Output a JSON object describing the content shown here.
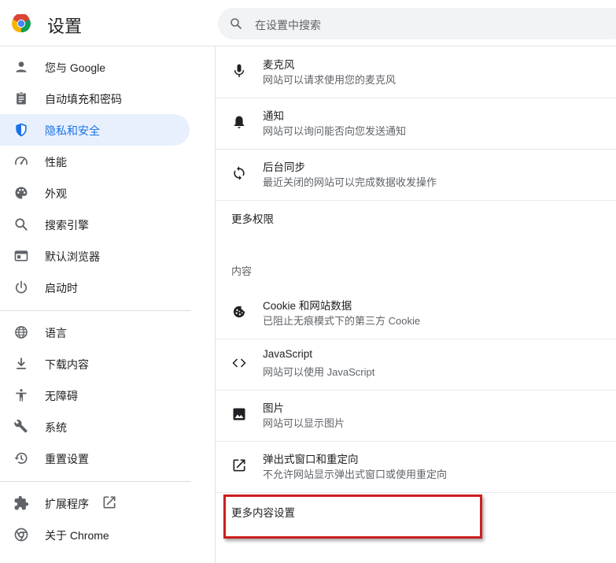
{
  "header": {
    "title": "设置",
    "search_placeholder": "在设置中搜索"
  },
  "sidebar": {
    "items": [
      {
        "label": "您与 Google",
        "icon": "person-icon"
      },
      {
        "label": "自动填充和密码",
        "icon": "clipboard-icon"
      },
      {
        "label": "隐私和安全",
        "icon": "shield-icon",
        "active": true
      },
      {
        "label": "性能",
        "icon": "speedometer-icon"
      },
      {
        "label": "外观",
        "icon": "palette-icon"
      },
      {
        "label": "搜索引擎",
        "icon": "search-icon"
      },
      {
        "label": "默认浏览器",
        "icon": "browser-window-icon"
      },
      {
        "label": "启动时",
        "icon": "power-icon"
      },
      {
        "label": "语言",
        "icon": "globe-icon"
      },
      {
        "label": "下载内容",
        "icon": "download-icon"
      },
      {
        "label": "无障碍",
        "icon": "accessibility-icon"
      },
      {
        "label": "系统",
        "icon": "wrench-icon"
      },
      {
        "label": "重置设置",
        "icon": "history-icon"
      },
      {
        "label": "扩展程序",
        "icon": "puzzle-icon"
      },
      {
        "label": "关于 Chrome",
        "icon": "chrome-icon"
      }
    ]
  },
  "content": {
    "rows_top": [
      {
        "title": "麦克风",
        "sub": "网站可以请求使用您的麦克风",
        "icon": "microphone-icon"
      },
      {
        "title": "通知",
        "sub": "网站可以询问能否向您发送通知",
        "icon": "bell-icon"
      },
      {
        "title": "后台同步",
        "sub": "最近关闭的网站可以完成数据收发操作",
        "icon": "sync-icon"
      }
    ],
    "more_permissions": "更多权限",
    "content_header": "内容",
    "rows_content": [
      {
        "title": "Cookie 和网站数据",
        "sub": "已阻止无痕模式下的第三方 Cookie",
        "icon": "cookie-icon"
      },
      {
        "title": "JavaScript",
        "sub": "网站可以使用 JavaScript",
        "icon": "code-icon"
      },
      {
        "title": "图片",
        "sub": "网站可以显示图片",
        "icon": "image-icon"
      },
      {
        "title": "弹出式窗口和重定向",
        "sub": "不允许网站显示弹出式窗口或使用重定向",
        "icon": "open-in-new-icon"
      }
    ],
    "more_content_settings": "更多内容设置"
  },
  "colors": {
    "accent": "#1a73e8",
    "active_bg": "#e8f0fe",
    "highlight_border": "#cc1f1f"
  }
}
